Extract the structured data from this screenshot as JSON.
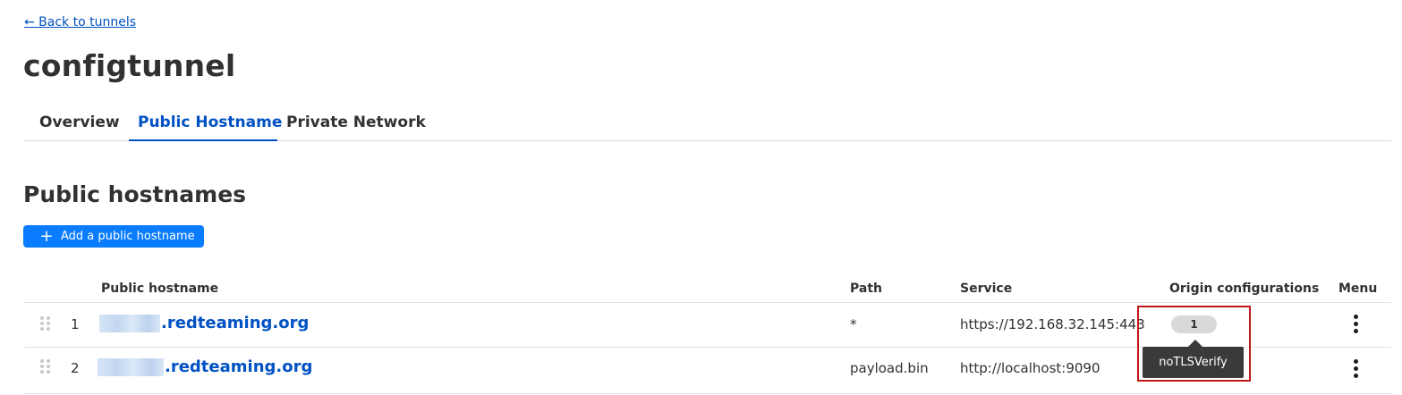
{
  "nav": {
    "back_label": "← Back to tunnels"
  },
  "page": {
    "title": "configtunnel"
  },
  "tabs": [
    {
      "label": "Overview",
      "active": false
    },
    {
      "label": "Public Hostname",
      "active": true
    },
    {
      "label": "Private Network",
      "active": false
    }
  ],
  "section": {
    "title": "Public hostnames",
    "add_button_label": "Add a public hostname"
  },
  "table": {
    "headers": {
      "hostname": "Public hostname",
      "path": "Path",
      "service": "Service",
      "origin": "Origin configurations",
      "menu": "Menu"
    },
    "rows": [
      {
        "index": "1",
        "hostname_suffix": ".redteaming.org",
        "path": "*",
        "service": "https://192.168.32.145:443",
        "origin_count": "1"
      },
      {
        "index": "2",
        "hostname_suffix": ".redteaming.org",
        "path": "payload.bin",
        "service": "http://localhost:9090",
        "origin_count": ""
      }
    ]
  },
  "tooltip": {
    "text": "noTLSVerify"
  },
  "colors": {
    "accent": "#0051c3",
    "button": "#0a7cff",
    "highlight": "#c0191c"
  },
  "icons": {
    "plus": "plus-icon",
    "drag": "drag-handle-icon",
    "menu": "kebab-menu-icon"
  }
}
